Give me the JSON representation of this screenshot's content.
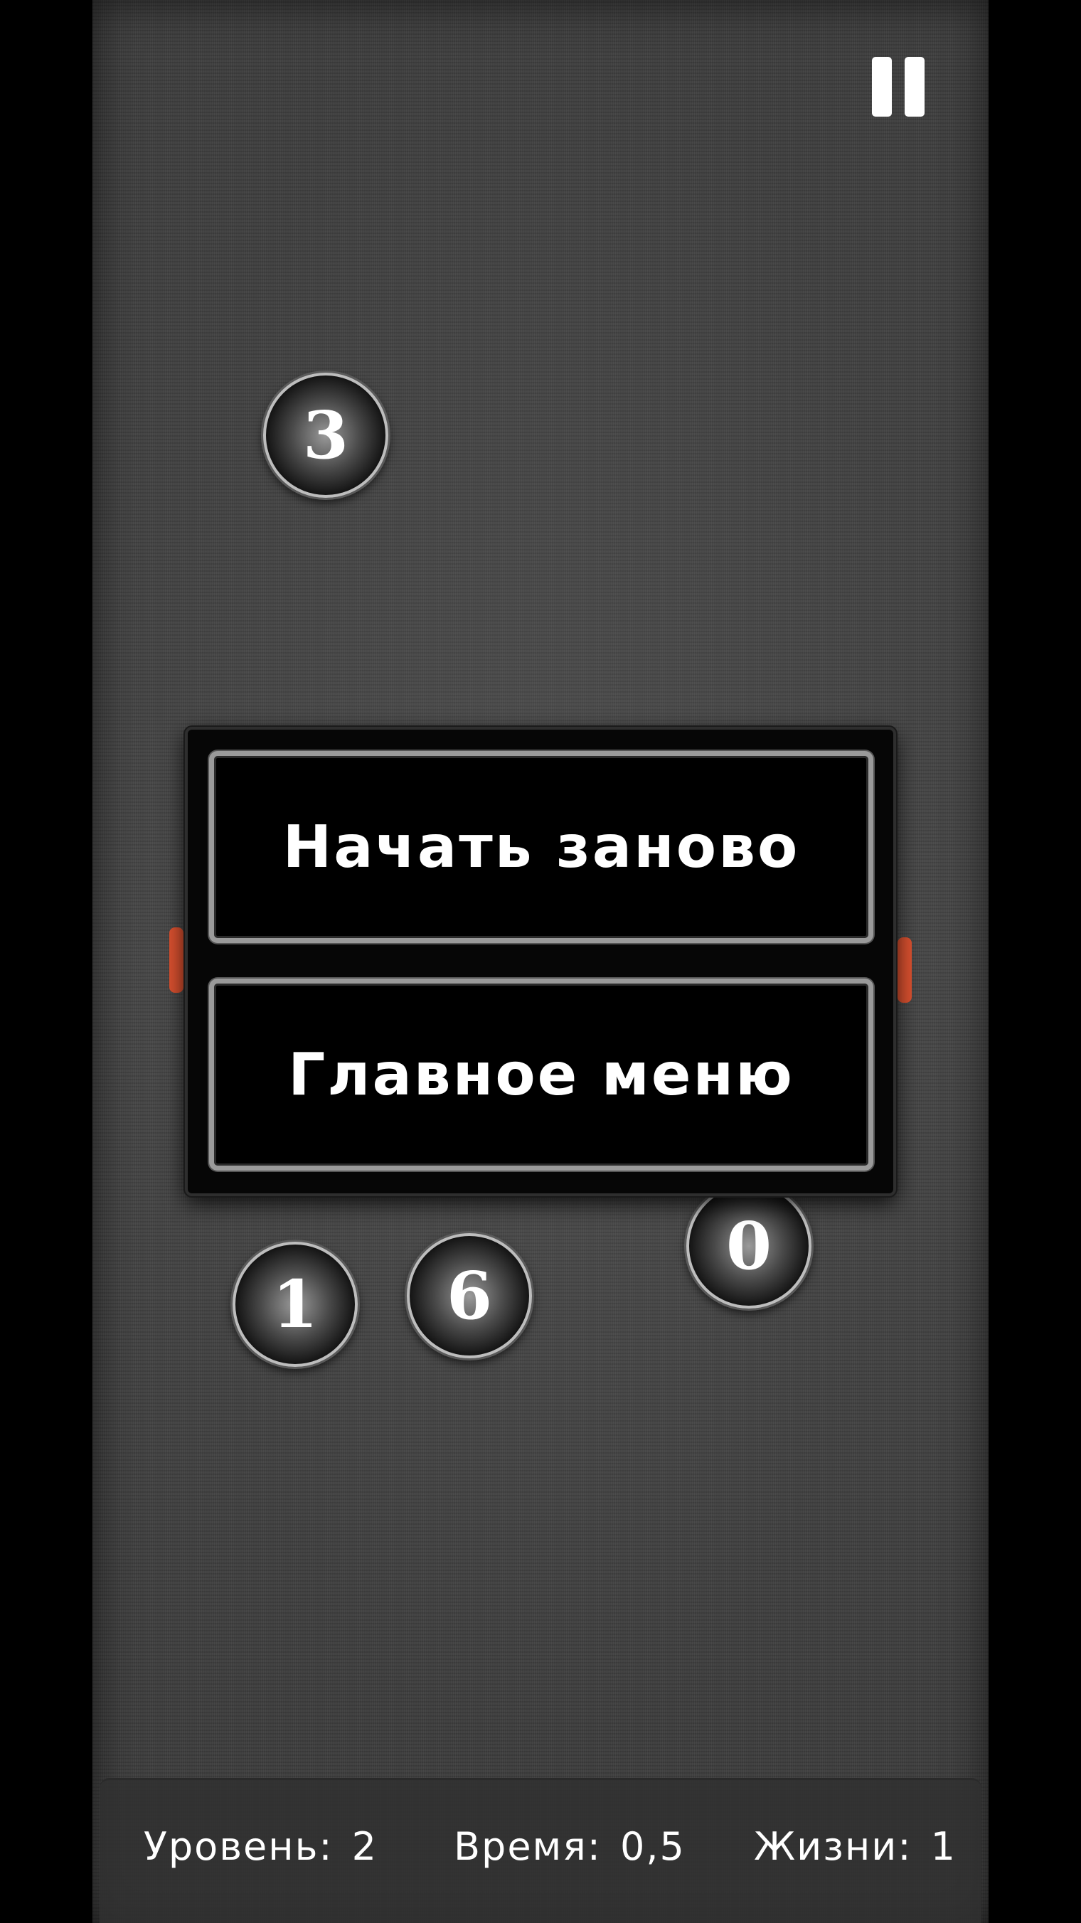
{
  "game": {
    "balls": [
      {
        "id": "ball-3",
        "number": "3"
      },
      {
        "id": "ball-0",
        "number": "0"
      },
      {
        "id": "ball-1",
        "number": "1"
      },
      {
        "id": "ball-6",
        "number": "6"
      }
    ],
    "accent_color": "#d8502f"
  },
  "menu": {
    "restart_label": "Начать заново",
    "main_menu_label": "Главное меню"
  },
  "status": {
    "level_label": "Уровень:",
    "level_value": "2",
    "time_label": "Время:",
    "time_value": "0,5",
    "lives_label": "Жизни:",
    "lives_value": "1"
  },
  "icons": {
    "pause": "pause-icon"
  }
}
